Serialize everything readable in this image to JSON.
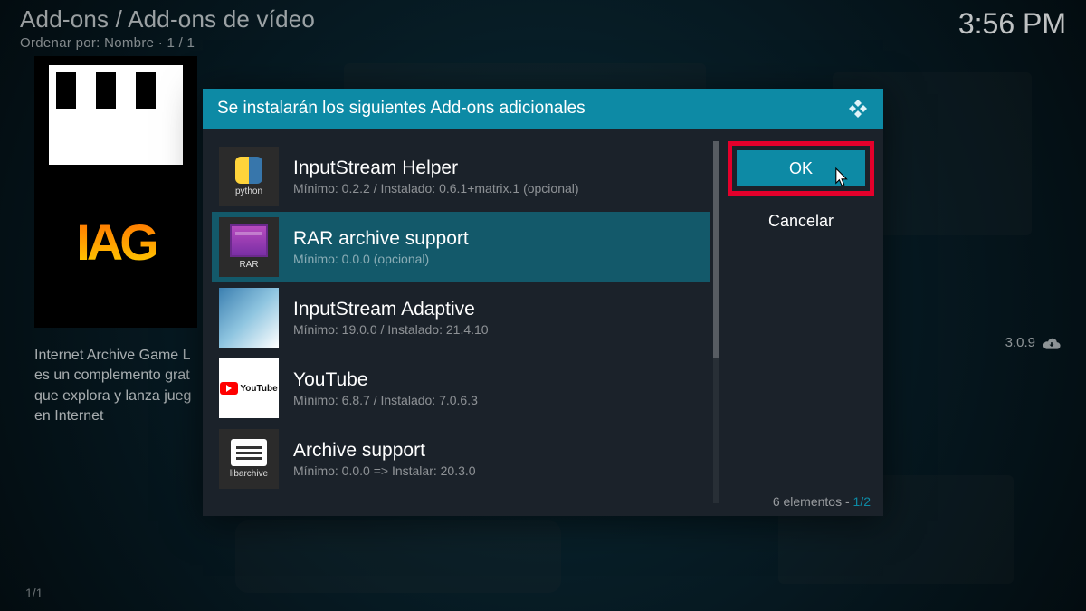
{
  "header": {
    "breadcrumb": "Add-ons / Add-ons de vídeo",
    "sort_line": "Ordenar por: Nombre  ·  1 / 1",
    "clock": "3:56 PM"
  },
  "preview": {
    "description": "Internet Archive Game L\nes un complemento grat\nque explora y lanza jueg\nen Internet"
  },
  "version": "3.0.9",
  "page_counter": "1/1",
  "dialog": {
    "title": "Se instalarán los siguientes Add-ons adicionales",
    "addons": [
      {
        "name": "InputStream Helper",
        "subtitle": "Mínimo: 0.2.2 / Instalado: 0.6.1+matrix.1 (opcional)",
        "icon_caption": "python",
        "icon_kind": "python"
      },
      {
        "name": "RAR archive support",
        "subtitle": "Mínimo: 0.0.0 (opcional)",
        "icon_caption": "RAR",
        "icon_kind": "rar",
        "selected": true
      },
      {
        "name": "InputStream Adaptive",
        "subtitle": "Mínimo: 19.0.0 / Instalado: 21.4.10",
        "icon_caption": "",
        "icon_kind": "adaptive"
      },
      {
        "name": "YouTube",
        "subtitle": "Mínimo: 6.8.7 / Instalado: 7.0.6.3",
        "icon_caption": "",
        "icon_kind": "youtube"
      },
      {
        "name": "Archive support",
        "subtitle": "Mínimo: 0.0.0 => Instalar: 20.3.0",
        "icon_caption": "libarchive",
        "icon_kind": "libarchive"
      }
    ],
    "buttons": {
      "ok": "OK",
      "cancel": "Cancelar"
    },
    "footer": {
      "label": "6 elementos - ",
      "count": "1/2"
    }
  }
}
